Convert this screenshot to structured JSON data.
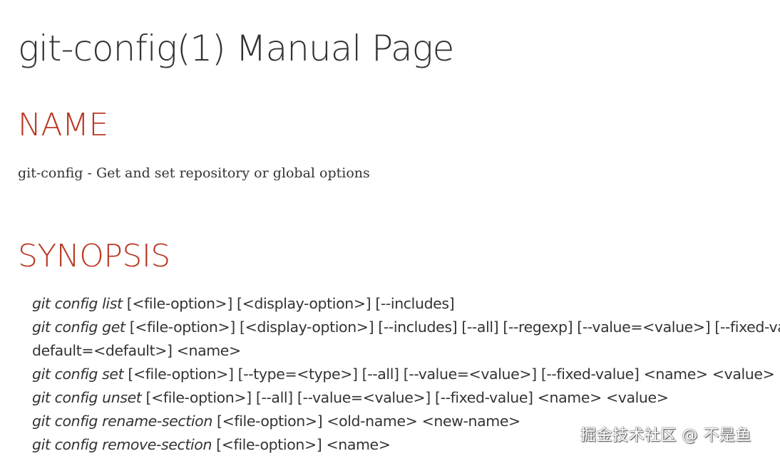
{
  "page": {
    "title": "git-config(1) Manual Page"
  },
  "name_section": {
    "heading": "NAME",
    "description": "git-config - Get and set repository or global options"
  },
  "synopsis_section": {
    "heading": "SYNOPSIS",
    "lines": [
      {
        "cmd": "git config list",
        "args": " [<file-option>] [<display-option>] [--includes]"
      },
      {
        "cmd": "git config get",
        "args": " [<file-option>] [<display-option>] [--includes] [--all] [--regexp] [--value=<value>] [--fixed-va"
      },
      {
        "cmd": "",
        "args": "default=<default>] <name>"
      },
      {
        "cmd": "git config set",
        "args": " [<file-option>] [--type=<type>] [--all] [--value=<value>] [--fixed-value] <name> <value>"
      },
      {
        "cmd": "git config unset",
        "args": " [<file-option>] [--all] [--value=<value>] [--fixed-value] <name> <value>"
      },
      {
        "cmd": "git config rename-section",
        "args": " [<file-option>] <old-name> <new-name>"
      },
      {
        "cmd": "git config remove-section",
        "args": " [<file-option>] <name>"
      }
    ]
  },
  "watermark": {
    "text": "掘金技术社区 @ 不是鱼"
  },
  "colors": {
    "heading_accent": "#ba3925",
    "body_text": "#333333"
  }
}
